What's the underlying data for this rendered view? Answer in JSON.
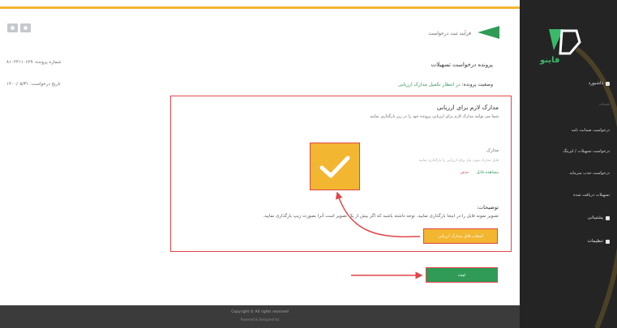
{
  "header": {
    "title": "فرآیند ثبت درخواست"
  },
  "request": {
    "page_title": "پرونده درخواست تسهیلات",
    "number_text": "شماره پرونده: ۸۱۰۲۴۱۱۰۶۲۹",
    "status_label": "وضعیت پرونده:",
    "status_value": "در انتظار تکمیل مدارک ارزیابی",
    "date_text": "تاریخ درخواست: ۱۴۰۰/۰۵/۳۱"
  },
  "panel": {
    "title": "مدارک لازم برای ارزیابی",
    "subtitle": "شما می توانید مدارک لازم برای ارزیابی پرونده خود را در زیر بارگذاری نمایید",
    "docs_label": "مدارک",
    "docs_hint": "فایل مدارک مورد نیاز برای ارزیابی را بارگذاری نمایید",
    "view_link": "مشاهده فایل",
    "delete_link": "حذف",
    "desc_label": "توضیحات:",
    "desc_text": "تصویر نمونه فایل را در اینجا بارگذاری نمایید. توجه داشته باشید که اگر بیش از یک تصویر است آنرا بصورت زیپ بارگذاری نمایید.",
    "upload_button": "انتخاب فایل مدارک ارزیابی"
  },
  "actions": {
    "submit_button": "ثبت"
  },
  "footer": {
    "line1": "Copyright ©  All rights reserved",
    "line2": "Powered & Designed by"
  },
  "sidebar": {
    "logo_text": "فاینو",
    "dashboard": "داشبورد",
    "services_cat": "خدمات",
    "items": [
      "درخواست ضمانت نامه",
      "درخواست تسهیلات / لیزینگ",
      "درخواست جذب سرمایه",
      "تسهیلات دریافت شده"
    ],
    "support": "پشتیبانی",
    "settings": "تنظیمات"
  },
  "colors": {
    "accent_yellow": "#f2b630",
    "brand_green": "#2f9b57",
    "highlight_red": "#e0454a",
    "sidebar_bg": "#242424",
    "footer_bg": "#3b3b3b"
  }
}
